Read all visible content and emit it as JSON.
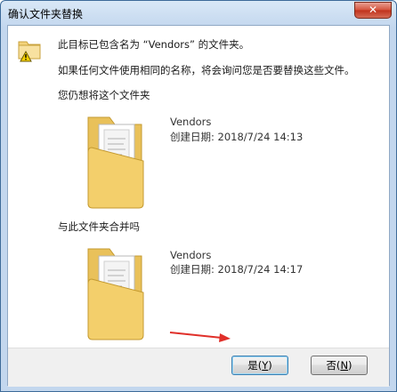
{
  "window": {
    "title": "确认文件夹替换",
    "close_label": "✕"
  },
  "message": {
    "line1": "此目标已包含名为 “Vendors” 的文件夹。",
    "line2": "如果任何文件使用相同的名称，将会询问您是否要替换这些文件。",
    "line3": "您仍想将这个文件夹",
    "line4": "与此文件夹合并吗"
  },
  "target_folder": {
    "name": "Vendors",
    "created": "创建日期: 2018/7/24 14:13"
  },
  "source_folder": {
    "name": "Vendors",
    "created": "创建日期: 2018/7/24 14:17"
  },
  "buttons": {
    "yes_label": "是(",
    "yes_key": "Y",
    "yes_end": ")",
    "no_label": "否(",
    "no_key": "N",
    "no_end": ")"
  },
  "colors": {
    "accent": "#3c7fb1",
    "annotation_arrow": "#e0302a",
    "folder": "#f3cf6b"
  }
}
